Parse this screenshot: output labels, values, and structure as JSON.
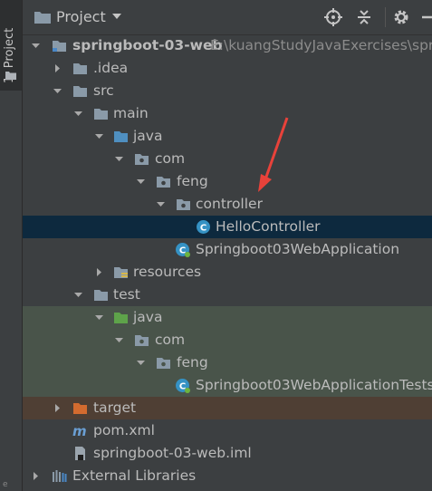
{
  "sidebar": {
    "tab_label": "1: Project",
    "bottom_letter": "e"
  },
  "header": {
    "title": "Project"
  },
  "tree": [
    {
      "label": "springboot-03-web",
      "path": "E:\\kuangStudyJavaExercises\\sprin",
      "icon": "module-folder-icon",
      "bold": true,
      "expanded": true
    },
    {
      "label": ".idea",
      "icon": "folder-icon",
      "expanded": false
    },
    {
      "label": "src",
      "icon": "folder-icon",
      "expanded": true
    },
    {
      "label": "main",
      "icon": "folder-icon",
      "expanded": true
    },
    {
      "label": "java",
      "icon": "source-root-folder-icon",
      "expanded": true
    },
    {
      "label": "com",
      "icon": "package-icon",
      "expanded": true
    },
    {
      "label": "feng",
      "icon": "package-icon",
      "expanded": true
    },
    {
      "label": "controller",
      "icon": "package-icon",
      "expanded": true
    },
    {
      "label": "HelloController",
      "icon": "class-icon",
      "selected": true
    },
    {
      "label": "Springboot03WebApplication",
      "icon": "spring-boot-class-icon"
    },
    {
      "label": "resources",
      "icon": "resources-folder-icon",
      "expanded": false
    },
    {
      "label": "test",
      "icon": "folder-icon",
      "expanded": true
    },
    {
      "label": "java",
      "icon": "test-root-folder-icon",
      "expanded": true
    },
    {
      "label": "com",
      "icon": "package-icon",
      "expanded": true
    },
    {
      "label": "feng",
      "icon": "package-icon",
      "expanded": true
    },
    {
      "label": "Springboot03WebApplicationTests",
      "icon": "spring-boot-class-icon"
    },
    {
      "label": "target",
      "icon": "excluded-folder-icon",
      "expanded": false
    },
    {
      "label": "pom.xml",
      "icon": "maven-icon"
    },
    {
      "label": "springboot-03-web.iml",
      "icon": "iml-file-icon"
    },
    {
      "label": "External Libraries",
      "icon": "libraries-icon",
      "expanded": false
    }
  ],
  "colors": {
    "background": "#3c3f41",
    "selection": "#0d293e",
    "test_highlight": "#49544a",
    "excluded_highlight": "#4f3f34",
    "annotation_arrow": "#e8423a"
  }
}
